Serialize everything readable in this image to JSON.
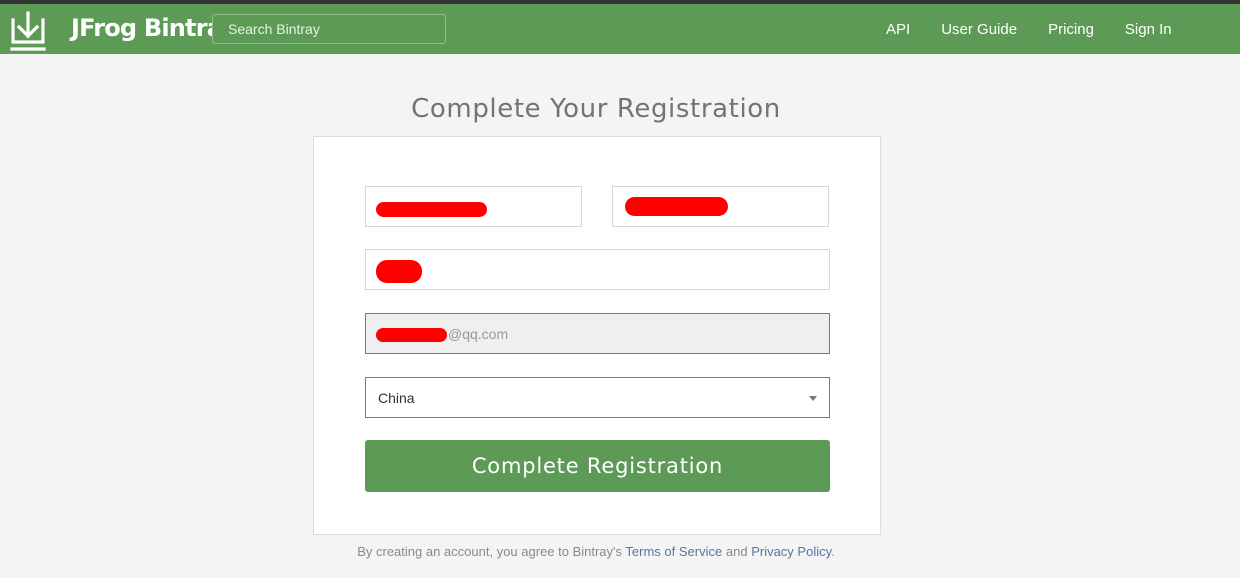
{
  "header": {
    "brand": "JFrog Bintray",
    "search_placeholder": "Search Bintray",
    "nav": [
      "API",
      "User Guide",
      "Pricing",
      "Sign In"
    ]
  },
  "page": {
    "title": "Complete Your Registration"
  },
  "form": {
    "email_visible_suffix": "@qq.com",
    "country": "China",
    "submit_label": "Complete Registration"
  },
  "terms": {
    "prefix": "By creating an account, you agree to Bintray's",
    "terms_link": "Terms of Service",
    "conjunction": "and",
    "privacy_link": "Privacy Policy",
    "suffix": "."
  },
  "colors": {
    "header_green": "#5c9a56",
    "error_border": "#c9575a",
    "redaction": "#ff0000",
    "link": "#5577a0"
  },
  "icons": {
    "logo": "download-arrow-icon",
    "select": "chevron-down-icon"
  }
}
